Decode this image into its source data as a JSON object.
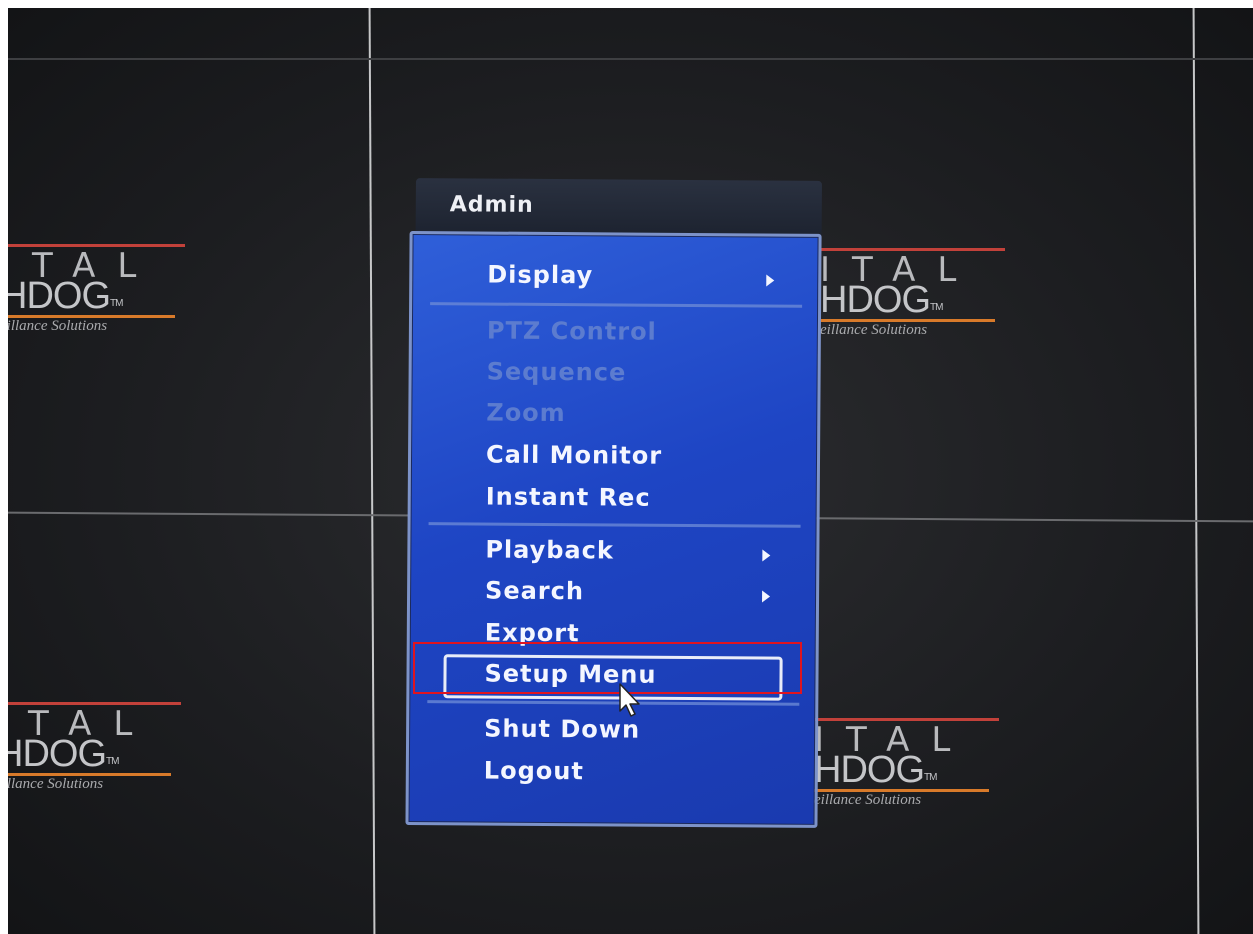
{
  "menu": {
    "title": "Admin",
    "items": [
      {
        "label": "Display",
        "enabled": true,
        "submenu": true
      },
      {
        "label": "PTZ Control",
        "enabled": false,
        "submenu": false
      },
      {
        "label": "Sequence",
        "enabled": false,
        "submenu": false
      },
      {
        "label": "Zoom",
        "enabled": false,
        "submenu": false
      },
      {
        "label": "Call Monitor",
        "enabled": true,
        "submenu": false
      },
      {
        "label": "Instant Rec",
        "enabled": true,
        "submenu": false
      },
      {
        "label": "Playback",
        "enabled": true,
        "submenu": true
      },
      {
        "label": "Search",
        "enabled": true,
        "submenu": true
      },
      {
        "label": "Export",
        "enabled": true,
        "submenu": false
      },
      {
        "label": "Setup Menu",
        "enabled": true,
        "submenu": false,
        "selected": true
      },
      {
        "label": "Shut Down",
        "enabled": true,
        "submenu": false
      },
      {
        "label": "Logout",
        "enabled": true,
        "submenu": false
      }
    ]
  },
  "tiles": {
    "logo_letters": "ITAL",
    "logo_brand": "HDOG",
    "logo_tm": "TM",
    "logo_tagline": "eillance Solutions"
  },
  "colors": {
    "menu_body": "#1e45c4",
    "highlight_outline": "#e0141f"
  },
  "icons": {
    "submenu_arrow": "triangle-right",
    "pointer": "mouse-cursor-arrow"
  }
}
